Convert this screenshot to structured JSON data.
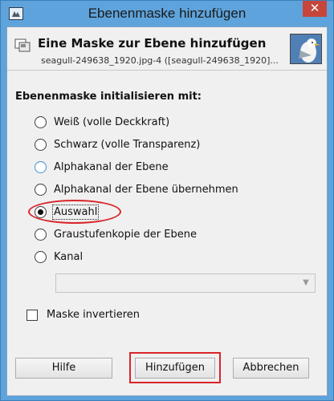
{
  "window": {
    "title": "Ebenenmaske hinzufügen",
    "close_label": "✕"
  },
  "header": {
    "title": "Eine Maske zur Ebene hinzufügen",
    "subtitle": "seagull-249638_1920.jpg-4 ([seagull-249638_1920]..."
  },
  "init": {
    "label": "Ebenenmaske initialisieren mit:",
    "options": [
      {
        "label": "Weiß (volle Deckkraft)",
        "checked": false
      },
      {
        "label": "Schwarz (volle Transparenz)",
        "checked": false
      },
      {
        "label": "Alphakanal der Ebene",
        "checked": false
      },
      {
        "label": "Alphakanal der Ebene übernehmen",
        "checked": false
      },
      {
        "label": "Auswahl",
        "checked": true
      },
      {
        "label": "Graustufenkopie der Ebene",
        "checked": false
      },
      {
        "label": "Kanal",
        "checked": false
      }
    ],
    "channel_select_value": ""
  },
  "invert": {
    "label": "Maske invertieren",
    "checked": false
  },
  "buttons": {
    "help": "Hilfe",
    "add": "Hinzufügen",
    "cancel": "Abbrechen"
  },
  "colors": {
    "titlebar": "#5ea3db",
    "close": "#c7463b",
    "highlight": "#d9242a"
  }
}
